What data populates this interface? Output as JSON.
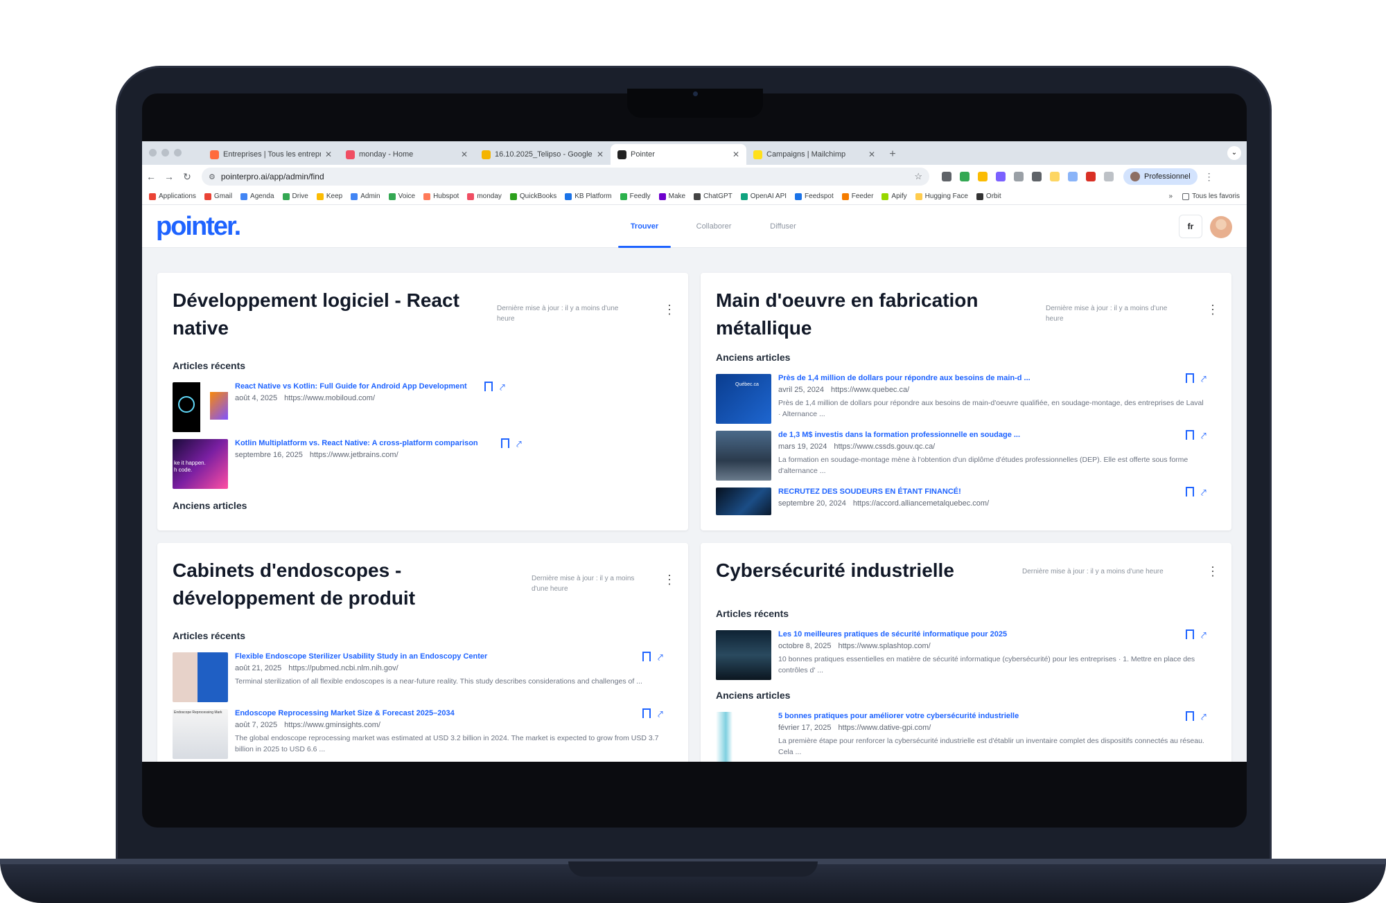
{
  "browser": {
    "tabs": [
      {
        "title": "Entreprises | Tous les entrepr",
        "fav_color": "#ff6b3d",
        "active": false
      },
      {
        "title": "monday - Home",
        "fav_color": "#f04e63",
        "active": false
      },
      {
        "title": "16.10.2025_Telipso - Google",
        "fav_color": "#f4b400",
        "active": false
      },
      {
        "title": "Pointer",
        "fav_color": "#222222",
        "active": true
      },
      {
        "title": "Campaigns | Mailchimp",
        "fav_color": "#ffe01b",
        "active": false
      }
    ],
    "url": "pointerpro.ai/app/admin/find",
    "profile_label": "Professionnel",
    "bookmarks": [
      "Applications",
      "Gmail",
      "Agenda",
      "Drive",
      "Keep",
      "Admin",
      "Voice",
      "Hubspot",
      "monday",
      "QuickBooks",
      "KB Platform",
      "Feedly",
      "Make",
      "ChatGPT",
      "OpenAI API",
      "Feedspot",
      "Feeder",
      "Apify",
      "Hugging Face",
      "Orbit"
    ],
    "bookmarks_more": "»",
    "all_bookmarks": "Tous les favoris"
  },
  "app": {
    "logo": "pointer.",
    "nav": [
      "Trouver",
      "Collaborer",
      "Diffuser"
    ],
    "lang": "fr"
  },
  "cards": [
    {
      "title": "Développement logiciel - React native",
      "updated": "Dernière mise à jour : il y a moins d'une heure",
      "sections": [
        {
          "label": "Articles récents",
          "items": [
            {
              "title": "React Native vs Kotlin: Full Guide for Android App Development",
              "date": "août 4, 2025",
              "url": "https://www.mobiloud.com/",
              "desc": ""
            },
            {
              "title": "Kotlin Multiplatform vs. React Native: A cross-platform comparison",
              "date": "septembre 16, 2025",
              "url": "https://www.jetbrains.com/",
              "desc": "",
              "thumb_text": "ke it happen.\nh code."
            }
          ]
        },
        {
          "label": "Anciens articles",
          "items": []
        }
      ]
    },
    {
      "title": "Main d'oeuvre en fabrication métallique",
      "updated": "Dernière mise à jour : il y a moins d'une heure",
      "sections": [
        {
          "label": "Anciens articles",
          "items": [
            {
              "title": "Près de 1,4 million de dollars pour répondre aux besoins de main-d ...",
              "date": "avril 25, 2024",
              "url": "https://www.quebec.ca/",
              "desc": "Près de 1,4 million de dollars pour répondre aux besoins de main-d'oeuvre qualifiée, en soudage-montage, des entreprises de Laval · Alternance ...",
              "thumb_text": "Québec.ca"
            },
            {
              "title": "de 1,3 M$ investis dans la formation professionnelle en soudage ...",
              "date": "mars 19, 2024",
              "url": "https://www.cssds.gouv.qc.ca/",
              "desc": "La formation en soudage-montage mène à l'obtention d'un diplôme d'études professionnelles (DEP). Elle est offerte sous forme d'alternance ..."
            },
            {
              "title": "RECRUTEZ DES SOUDEURS EN ÉTANT FINANCÉ!",
              "date": "septembre 20, 2024",
              "url": "https://accord.alliancemetalquebec.com/",
              "desc": ""
            }
          ]
        }
      ]
    },
    {
      "title": "Cabinets d'endoscopes - développement de produit",
      "updated": "Dernière mise à jour : il y a moins d'une heure",
      "sections": [
        {
          "label": "Articles récents",
          "items": [
            {
              "title": "Flexible Endoscope Sterilizer Usability Study in an Endoscopy Center",
              "date": "août 21, 2025",
              "url": "https://pubmed.ncbi.nlm.nih.gov/",
              "desc": "Terminal sterilization of all flexible endoscopes is a near-future reality. This study describes considerations and challenges of ..."
            },
            {
              "title": "Endoscope Reprocessing Market Size & Forecast 2025–2034",
              "date": "août 7, 2025",
              "url": "https://www.gminsights.com/",
              "desc": "The global endoscope reprocessing market was estimated at USD 3.2 billion in 2024. The market is expected to grow from USD 3.7 billion in 2025 to USD 6.6 ...",
              "thumb_text": "Endoscope Reprocessing Mark"
            }
          ]
        }
      ]
    },
    {
      "title": "Cybersécurité industrielle",
      "updated": "Dernière mise à jour : il y a moins d'une heure",
      "sections": [
        {
          "label": "Articles récents",
          "items": [
            {
              "title": "Les 10 meilleures pratiques de sécurité informatique pour 2025",
              "date": "octobre 8, 2025",
              "url": "https://www.splashtop.com/",
              "desc": "10 bonnes pratiques essentielles en matière de sécurité informatique (cybersécurité) pour les entreprises · 1. Mettre en place des contrôles d' ..."
            }
          ]
        },
        {
          "label": "Anciens articles",
          "items": [
            {
              "title": "5 bonnes pratiques pour améliorer votre cybersécurité industrielle",
              "date": "février 17, 2025",
              "url": "https://www.dative-gpi.com/",
              "desc": "La première étape pour renforcer la cybersécurité industrielle est d'établir un inventaire complet des dispositifs connectés au réseau. Cela ..."
            }
          ]
        }
      ]
    }
  ],
  "colors": {
    "accent": "#1e63ff",
    "title": "#111827"
  }
}
